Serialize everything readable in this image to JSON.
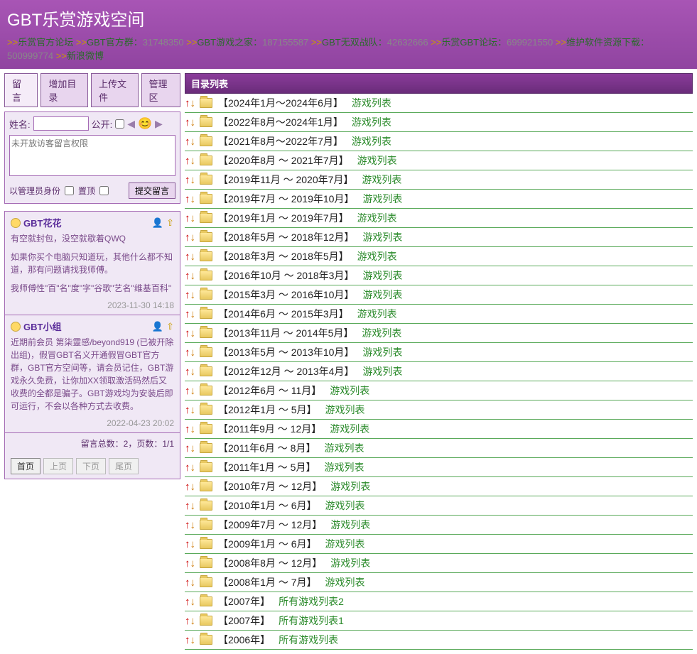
{
  "header": {
    "title": "GBT乐赏游戏空间",
    "nav": [
      {
        "label": "乐赏官方论坛",
        "num": ""
      },
      {
        "label": "GBT官方群：",
        "num": "31748350"
      },
      {
        "label": "GBT游戏之家：",
        "num": "187155587"
      },
      {
        "label": "GBT无双战队：",
        "num": "42632666"
      },
      {
        "label": "乐赏GBT论坛：",
        "num": "699921550"
      },
      {
        "label": "维护软件资源下载：",
        "num": "500999774"
      },
      {
        "label": "新浪微博",
        "num": ""
      }
    ]
  },
  "sidebar": {
    "tabs": [
      "留 言",
      "增加目录",
      "上传文件",
      "管理区"
    ],
    "form": {
      "name_label": "姓名:",
      "public_label": "公开:",
      "textarea_placeholder": "未开放访客留言权限",
      "admin_label": "以管理员身份",
      "pin_label": "置顶",
      "submit_label": "提交留言"
    },
    "entries": [
      {
        "name": "GBT花花",
        "paras": [
          "有空就封包，没空就歇着QWQ",
          "如果你买个电脑只知道玩，其他什么都不知道，那有问题请找我师傅。",
          "我师傅性\"百\"名\"度\"字\"谷歌\"艺名\"维基百科\""
        ],
        "date": "2023-11-30 14:18"
      },
      {
        "name": "GBT小组",
        "paras": [
          "近期前会员 第柒靈感/beyond919 (已被开除出组)，假冒GBT名义开通假冒GBT官方群，GBT官方空间等，请会员记住，GBT游戏永久免费，让你加XX领取激活码然后又收费的全都是骗子。GBT游戏均为安装后即可运行，不会以各种方式去收费。"
        ],
        "date": "2022-04-23 20:02"
      }
    ],
    "footer": "留言总数：2，页数：1/1",
    "pager": [
      "首页",
      "上页",
      "下页",
      "尾页"
    ]
  },
  "content": {
    "list_header": "目录列表",
    "rows": [
      {
        "label": "【2024年1月～2024年6月】",
        "link": "游戏列表"
      },
      {
        "label": "【2022年8月～2024年1月】",
        "link": "游戏列表"
      },
      {
        "label": "【2021年8月～2022年7月】",
        "link": "游戏列表"
      },
      {
        "label": "【2020年8月 ～ 2021年7月】",
        "link": "游戏列表"
      },
      {
        "label": "【2019年11月 ～ 2020年7月】",
        "link": "游戏列表"
      },
      {
        "label": "【2019年7月 ～ 2019年10月】",
        "link": "游戏列表"
      },
      {
        "label": "【2019年1月 ～ 2019年7月】",
        "link": "游戏列表"
      },
      {
        "label": "【2018年5月 ～ 2018年12月】",
        "link": "游戏列表"
      },
      {
        "label": "【2018年3月 ～ 2018年5月】",
        "link": "游戏列表"
      },
      {
        "label": "【2016年10月 ～ 2018年3月】",
        "link": "游戏列表"
      },
      {
        "label": "【2015年3月 ～ 2016年10月】",
        "link": "游戏列表"
      },
      {
        "label": "【2014年6月 ～ 2015年3月】",
        "link": "游戏列表"
      },
      {
        "label": "【2013年11月 ～ 2014年5月】",
        "link": "游戏列表"
      },
      {
        "label": "【2013年5月 ～ 2013年10月】",
        "link": "游戏列表"
      },
      {
        "label": "【2012年12月 ～ 2013年4月】",
        "link": "游戏列表"
      },
      {
        "label": "【2012年6月 ～ 11月】",
        "link": "游戏列表"
      },
      {
        "label": "【2012年1月 ～ 5月】",
        "link": "游戏列表"
      },
      {
        "label": "【2011年9月 ～ 12月】",
        "link": "游戏列表"
      },
      {
        "label": "【2011年6月 ～ 8月】",
        "link": "游戏列表"
      },
      {
        "label": "【2011年1月 ～ 5月】",
        "link": "游戏列表"
      },
      {
        "label": "【2010年7月 ～ 12月】",
        "link": "游戏列表"
      },
      {
        "label": "【2010年1月 ～ 6月】",
        "link": "游戏列表"
      },
      {
        "label": "【2009年7月 ～ 12月】",
        "link": "游戏列表"
      },
      {
        "label": "【2009年1月 ～ 6月】",
        "link": "游戏列表"
      },
      {
        "label": "【2008年8月 ～ 12月】",
        "link": "游戏列表"
      },
      {
        "label": "【2008年1月 ～ 7月】",
        "link": "游戏列表"
      },
      {
        "label": "【2007年】",
        "link": "所有游戏列表2"
      },
      {
        "label": "【2007年】",
        "link": "所有游戏列表1"
      },
      {
        "label": "【2006年】",
        "link": "所有游戏列表"
      }
    ]
  }
}
